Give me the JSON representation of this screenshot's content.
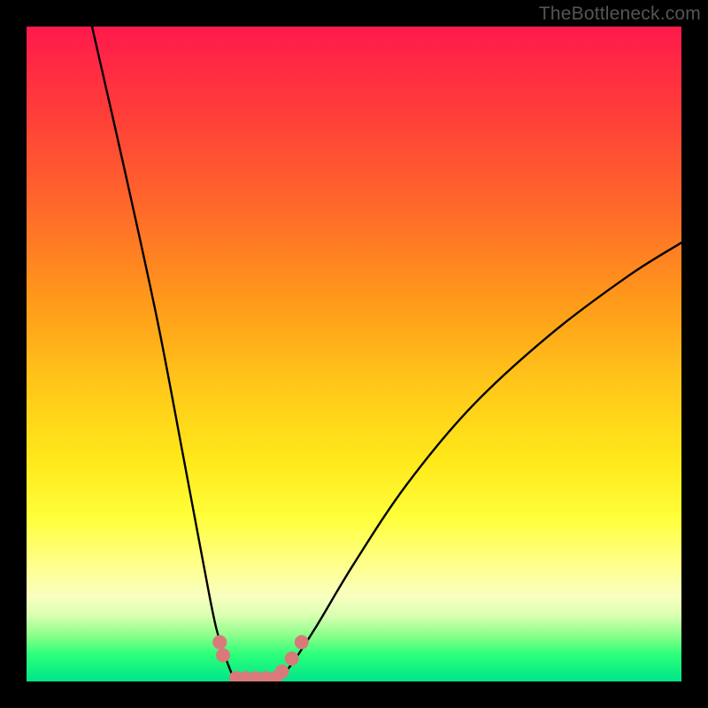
{
  "watermark": "TheBottleneck.com",
  "chart_data": {
    "type": "line",
    "title": "",
    "xlabel": "",
    "ylabel": "",
    "xlim": [
      0,
      100
    ],
    "ylim": [
      0,
      100
    ],
    "grid": false,
    "legend": false,
    "series": [
      {
        "name": "bottleneck-curve-left",
        "x": [
          10,
          15,
          20,
          24,
          27,
          29,
          31,
          32
        ],
        "y": [
          100,
          78,
          55,
          34,
          18,
          8,
          2,
          0
        ]
      },
      {
        "name": "bottleneck-curve-right",
        "x": [
          38,
          40,
          44,
          50,
          58,
          68,
          80,
          92,
          100
        ],
        "y": [
          0,
          2,
          8,
          18,
          30,
          42,
          53,
          62,
          67
        ]
      },
      {
        "name": "bottleneck-floor",
        "x": [
          32,
          34,
          36,
          38
        ],
        "y": [
          0,
          0,
          0,
          0
        ]
      }
    ],
    "markers": [
      {
        "name": "dot",
        "x": 29.5,
        "y": 6
      },
      {
        "name": "dot",
        "x": 30.0,
        "y": 4
      },
      {
        "name": "dot",
        "x": 32.0,
        "y": 0.5
      },
      {
        "name": "dot",
        "x": 33.5,
        "y": 0.5
      },
      {
        "name": "dot",
        "x": 35.0,
        "y": 0.5
      },
      {
        "name": "dot",
        "x": 36.5,
        "y": 0.5
      },
      {
        "name": "dot",
        "x": 38.0,
        "y": 0.5
      },
      {
        "name": "dot",
        "x": 39.0,
        "y": 1.5
      },
      {
        "name": "dot",
        "x": 40.5,
        "y": 3.5
      },
      {
        "name": "dot",
        "x": 42.0,
        "y": 6
      }
    ],
    "gradient_stops": [
      {
        "pos": 0,
        "color": "#ff1a4d"
      },
      {
        "pos": 50,
        "color": "#ffc81a"
      },
      {
        "pos": 80,
        "color": "#ffff3a"
      },
      {
        "pos": 100,
        "color": "#00e58a"
      }
    ]
  }
}
